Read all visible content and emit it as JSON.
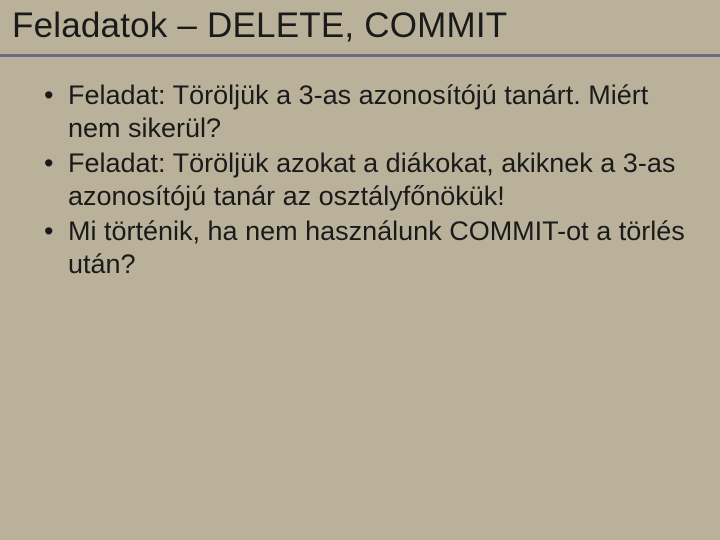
{
  "slide": {
    "title": "Feladatok – DELETE, COMMIT",
    "bullets": [
      "Feladat: Töröljük a 3-as azonosítójú tanárt. Miért nem sikerül?",
      "Feladat: Töröljük azokat a diákokat, akiknek a 3-as azonosítójú tanár az osztályfőnökük!",
      "Mi történik, ha nem használunk COMMIT-ot a törlés után?"
    ]
  }
}
